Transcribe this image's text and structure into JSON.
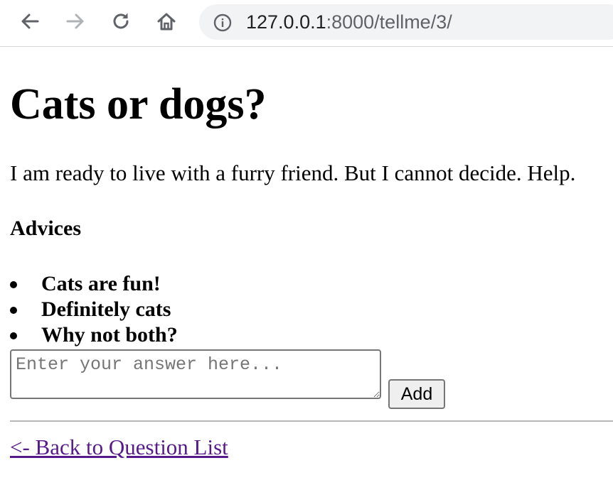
{
  "browser": {
    "url_host": "127.0.0.1",
    "url_rest": ":8000/tellme/3/",
    "icons": {
      "back": "arrow-left-icon",
      "forward": "arrow-right-icon",
      "reload": "reload-icon",
      "home": "home-icon",
      "info": "info-icon"
    }
  },
  "question": {
    "title": "Cats or dogs?",
    "body": "I am ready to live with a furry friend. But I cannot decide. Help."
  },
  "advices": {
    "heading": "Advices",
    "items": [
      "Cats are fun!",
      "Definitely cats",
      "Why not both?"
    ]
  },
  "form": {
    "answer_placeholder": "Enter your answer here...",
    "add_label": "Add"
  },
  "footer": {
    "back_link": "<- Back to Question List"
  },
  "colors": {
    "link_visited": "#551a8b",
    "omnibox_bg": "#f1f3f4",
    "toolbar_icon": "#5f6368"
  }
}
